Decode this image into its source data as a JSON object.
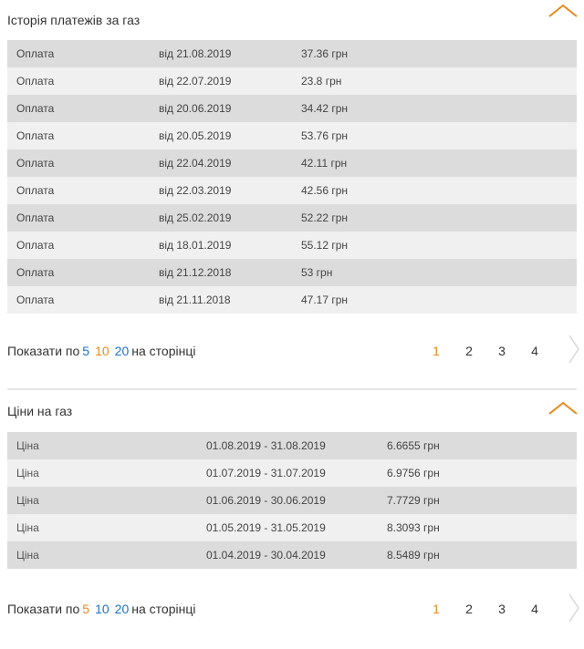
{
  "payments": {
    "title": "Історія платежів за газ",
    "rows": [
      {
        "type": "Оплата",
        "date": "від 21.08.2019",
        "amount": "37.36 грн"
      },
      {
        "type": "Оплата",
        "date": "від 22.07.2019",
        "amount": "23.8 грн"
      },
      {
        "type": "Оплата",
        "date": "від 20.06.2019",
        "amount": "34.42 грн"
      },
      {
        "type": "Оплата",
        "date": "від 20.05.2019",
        "amount": "53.76 грн"
      },
      {
        "type": "Оплата",
        "date": "від 22.04.2019",
        "amount": "42.11 грн"
      },
      {
        "type": "Оплата",
        "date": "від 22.03.2019",
        "amount": "42.56 грн"
      },
      {
        "type": "Оплата",
        "date": "від 25.02.2019",
        "amount": "52.22 грн"
      },
      {
        "type": "Оплата",
        "date": "від 18.01.2019",
        "amount": "55.12 грн"
      },
      {
        "type": "Оплата",
        "date": "від 21.12.2018",
        "amount": "53 грн"
      },
      {
        "type": "Оплата",
        "date": "від 21.11.2018",
        "amount": "47.17 грн"
      }
    ],
    "pager": {
      "label": "Показати по",
      "options": [
        "5",
        "10",
        "20"
      ],
      "selected": "10",
      "suffix": "на сторінці",
      "pages": [
        "1",
        "2",
        "3",
        "4"
      ],
      "current_page": "1"
    }
  },
  "prices": {
    "title": "Ціни на газ",
    "rows": [
      {
        "type": "Ціна",
        "period": "01.08.2019 - 31.08.2019",
        "price": "6.6655 грн"
      },
      {
        "type": "Ціна",
        "period": "01.07.2019 - 31.07.2019",
        "price": "6.9756 грн"
      },
      {
        "type": "Ціна",
        "period": "01.06.2019 - 30.06.2019",
        "price": "7.7729 грн"
      },
      {
        "type": "Ціна",
        "period": "01.05.2019 - 31.05.2019",
        "price": "8.3093 грн"
      },
      {
        "type": "Ціна",
        "period": "01.04.2019 - 30.04.2019",
        "price": "8.5489 грн"
      }
    ],
    "pager": {
      "label": "Показати по",
      "options": [
        "5",
        "10",
        "20"
      ],
      "selected": "5",
      "suffix": "на сторінці",
      "pages": [
        "1",
        "2",
        "3",
        "4"
      ],
      "current_page": "1"
    }
  },
  "icons": {
    "collapse": "chevron-up-icon",
    "next": "chevron-right-icon"
  },
  "colors": {
    "accent": "#e8891e",
    "link": "#1a73c7",
    "row_dark": "#dcdcdc",
    "row_light": "#f0f0f0"
  }
}
